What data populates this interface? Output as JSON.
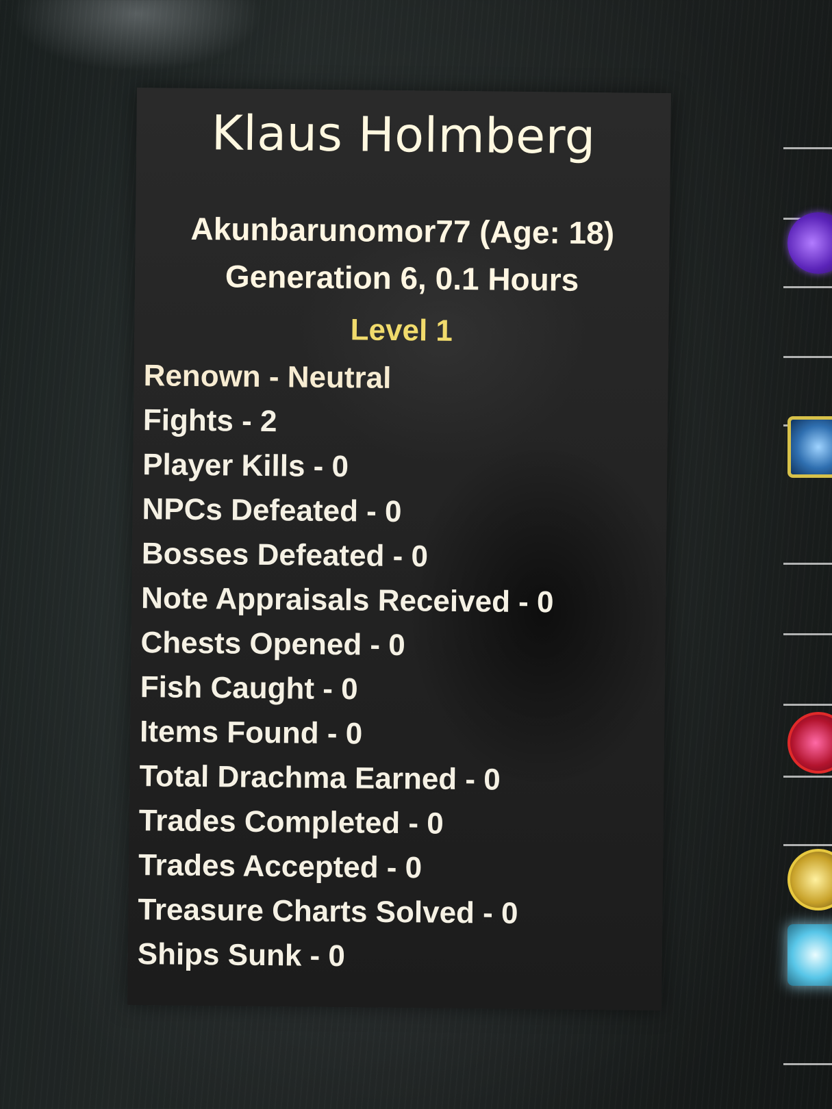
{
  "character": {
    "name": "Klaus Holmberg",
    "account": "Akunbarunomor77 (Age: 18)",
    "generation": "Generation 6, 0.1 Hours",
    "level": "Level 1"
  },
  "stats": [
    "Renown - Neutral",
    "Fights - 2",
    "Player Kills - 0",
    "NPCs Defeated - 0",
    "Bosses Defeated - 0",
    "Note Appraisals Received - 0",
    "Chests Opened - 0",
    "Fish Caught - 0",
    "Items Found - 0",
    "Total Drachma Earned - 0",
    "Trades Completed - 0",
    "Trades Accepted - 0",
    "Treasure Charts Solved - 0",
    "Ships Sunk - 0"
  ],
  "colors": {
    "name": "#fff8e0",
    "level": "#f1db6c",
    "text": "#f5f1e4",
    "panel": "#232323"
  },
  "side_icons": [
    "purple-orb-icon",
    "blue-shield-icon",
    "red-orb-icon",
    "gold-orb-icon",
    "cyan-crystal-icon"
  ]
}
